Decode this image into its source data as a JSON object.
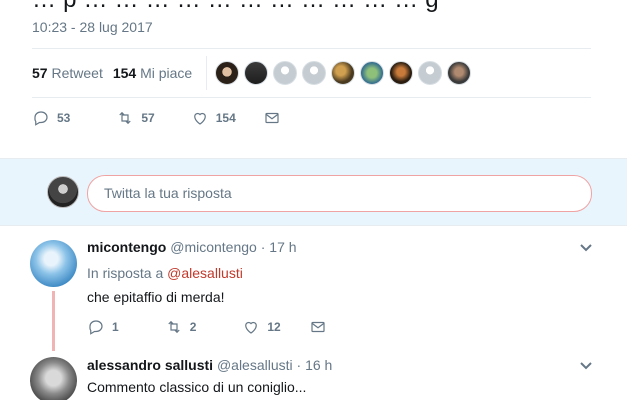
{
  "main_tweet": {
    "top_text_fragment": "… p … … … … … … … … … … … g",
    "timestamp": "10:23 - 28 lug 2017",
    "retweets_count": "57",
    "retweets_label": "Retweet",
    "likes_count": "154",
    "likes_label": "Mi piace",
    "actions": {
      "replies": "53",
      "retweets": "57",
      "likes": "154"
    }
  },
  "reply_box": {
    "placeholder": "Twitta la tua risposta"
  },
  "replies": [
    {
      "fullname": "micontengo",
      "handle": "@micontengo",
      "separator": "·",
      "time": "17 h",
      "context_prefix": "In risposta a",
      "context_handle": "@alesallusti",
      "text": "che epitaffio di merda!",
      "actions": {
        "replies": "1",
        "retweets": "2",
        "likes": "12"
      }
    },
    {
      "fullname": "alessandro sallusti",
      "handle": "@alesallusti",
      "separator": "·",
      "time": "16 h",
      "text": "Commento classico di un coniglio..."
    }
  ],
  "colors": {
    "accent": "#1da1f2",
    "muted": "#657786",
    "thread": "#f0b4b4",
    "reply_bg": "#e8f5fd"
  }
}
